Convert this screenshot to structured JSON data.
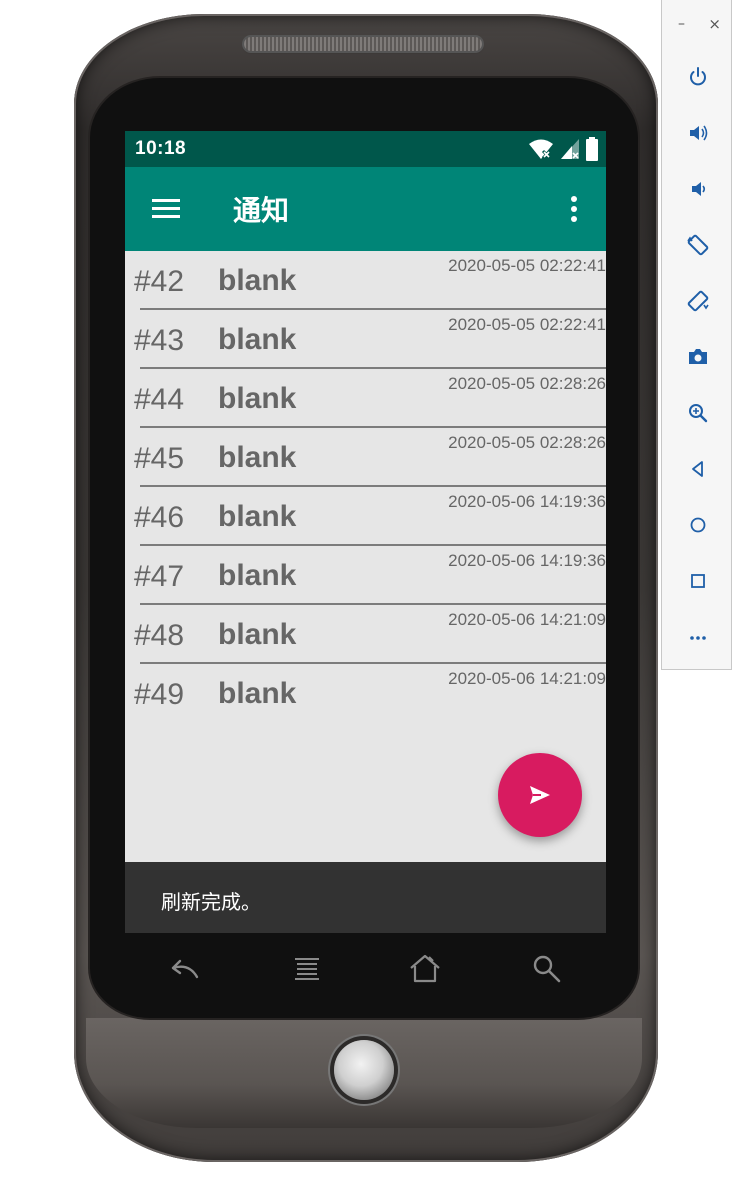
{
  "status_bar": {
    "time": "10:18"
  },
  "app_bar": {
    "title": "通知"
  },
  "notifications": [
    {
      "id": "#42",
      "title": "blank",
      "date": "2020-05-05 02:22:41"
    },
    {
      "id": "#43",
      "title": "blank",
      "date": "2020-05-05 02:22:41"
    },
    {
      "id": "#44",
      "title": "blank",
      "date": "2020-05-05 02:28:26"
    },
    {
      "id": "#45",
      "title": "blank",
      "date": "2020-05-05 02:28:26"
    },
    {
      "id": "#46",
      "title": "blank",
      "date": "2020-05-06 14:19:36"
    },
    {
      "id": "#47",
      "title": "blank",
      "date": "2020-05-06 14:19:36"
    },
    {
      "id": "#48",
      "title": "blank",
      "date": "2020-05-06 14:21:09"
    },
    {
      "id": "#49",
      "title": "blank",
      "date": "2020-05-06 14:21:09"
    }
  ],
  "snackbar": {
    "message": "刷新完成。"
  },
  "fab": {
    "icon": "send-icon"
  },
  "nav_bar": {
    "icons": [
      "back-icon",
      "menu-lines-icon",
      "home-icon",
      "search-icon"
    ]
  },
  "emulator_toolbar": {
    "minimize": "–",
    "close": "×",
    "buttons": [
      "power-icon",
      "volume-up-icon",
      "volume-down-icon",
      "rotate-left-icon",
      "rotate-right-icon",
      "camera-icon",
      "zoom-icon",
      "back-icon",
      "home-icon",
      "overview-icon",
      "more-icon"
    ]
  },
  "colors": {
    "status_bar": "#00574b",
    "app_bar": "#008577",
    "fab": "#d81b60",
    "list_background": "#e6e6e6",
    "snackbar": "#323232"
  }
}
